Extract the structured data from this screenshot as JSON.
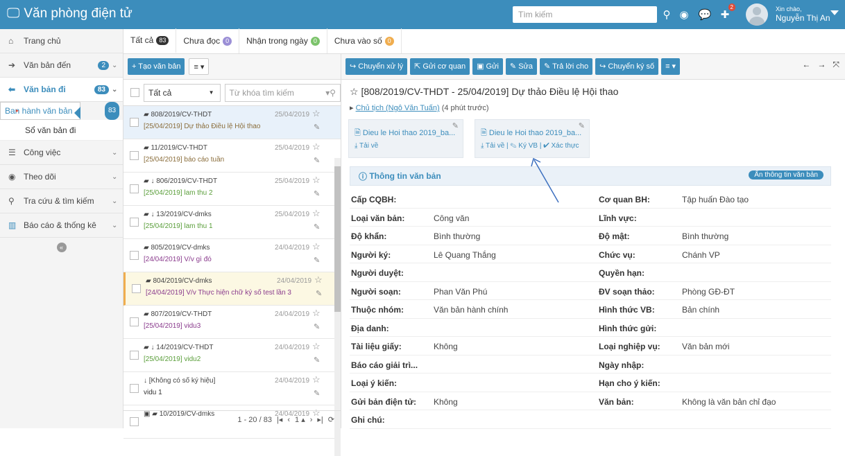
{
  "app": {
    "title": "Văn phòng điện tử"
  },
  "topbar": {
    "search_placeholder": "Tìm kiếm",
    "notif_count": "2",
    "greeting": "Xin chào,",
    "user_name": "Nguyễn Thị An"
  },
  "sidebar": {
    "items": [
      {
        "label": "Trang chủ",
        "icon": "home-icon"
      },
      {
        "label": "Văn bản đến",
        "badge": "2",
        "icon": "arrow-right-circle-icon"
      },
      {
        "label": "Văn bản đi",
        "badge": "83",
        "icon": "arrow-left-circle-icon"
      },
      {
        "label": "Công việc",
        "icon": "tasks-icon"
      },
      {
        "label": "Theo dõi",
        "icon": "eye-icon"
      },
      {
        "label": "Tra cứu & tìm kiếm",
        "icon": "search-icon"
      },
      {
        "label": "Báo cáo & thống kê",
        "icon": "bar-chart-icon"
      }
    ],
    "subitems": [
      {
        "label": "Ban hành văn bản",
        "badge": "83"
      },
      {
        "label": "Sổ văn bản đi"
      }
    ]
  },
  "tabs": [
    {
      "label": "Tất cả",
      "badge": "83",
      "color": "#333333"
    },
    {
      "label": "Chưa đọc",
      "badge": "0",
      "color": "#9b8fd6"
    },
    {
      "label": "Nhận trong ngày",
      "badge": "0",
      "color": "#7cc36b"
    },
    {
      "label": "Chưa vào số",
      "badge": "0",
      "color": "#f0ad4e"
    }
  ],
  "list_toolbar": {
    "new_label": "+ Tạo văn bản",
    "menu_label": "≡ ▾"
  },
  "filter": {
    "select_value": "Tất cả",
    "keyword_placeholder": "Từ khóa tìm kiếm"
  },
  "list": [
    {
      "code": "808/2019/CV-THDT",
      "date": "25/04/2019",
      "summary": "[25/04/2019] Dự thảo Điều lệ Hội thao",
      "style": "hl"
    },
    {
      "code": "11/2019/CV-THDT",
      "date": "25/04/2019",
      "summary": "[25/04/2019] báo cáo tuần",
      "style": ""
    },
    {
      "code": "806/2019/CV-THDT",
      "date": "25/04/2019",
      "summary": "[25/04/2019] lam thu 2",
      "style": "green",
      "down": true
    },
    {
      "code": "13/2019/CV-dmks",
      "date": "25/04/2019",
      "summary": "[25/04/2019] lam thu 1",
      "style": "green",
      "down": true
    },
    {
      "code": "805/2019/CV-dmks",
      "date": "24/04/2019",
      "summary": "[24/04/2019] V/v gì đó",
      "style": "purple"
    },
    {
      "code": "804/2019/CV-dmks",
      "date": "24/04/2019",
      "summary": "[24/04/2019] V/v Thực hiện chữ ký số test lần 3",
      "style": "yel"
    },
    {
      "code": "807/2019/CV-THDT",
      "date": "24/04/2019",
      "summary": "[25/04/2019] vidu3",
      "style": "purple"
    },
    {
      "code": "14/2019/CV-THDT",
      "date": "24/04/2019",
      "summary": "[25/04/2019] vidu2",
      "style": "green",
      "down": true
    },
    {
      "code": "[Không có số ký hiệu]",
      "date": "24/04/2019",
      "summary": "vidu 1",
      "style": "plain",
      "down": true,
      "nobook": true
    },
    {
      "code": "10/2019/CV-dmks",
      "date": "24/04/2019",
      "summary": "",
      "style": "plain",
      "img": true
    }
  ],
  "pager": {
    "range": "1 - 20 / 83",
    "page": "1"
  },
  "right_toolbar": {
    "buttons": [
      "Chuyển xử lý",
      "Gửi cơ quan",
      "Gửi",
      "Sửa",
      "Trả lời cho",
      "Chuyển ký số"
    ],
    "menu_label": "≡ ▾"
  },
  "doc": {
    "title": "[808/2019/CV-THDT - 25/04/2019] Dự thảo Điều lệ Hội thao",
    "sender_link": "Chủ tịch (Ngô Văn Tuấn)",
    "sender_time": "(4 phút trước)",
    "attachments": [
      {
        "name": "Dieu le Hoi thao 2019_ba...",
        "actions": "Tải về"
      },
      {
        "name": "Dieu le Hoi thao 2019_ba...",
        "actions": "Tải về | ✎ Ký VB | ✔ Xác thực"
      }
    ],
    "info_title": "Thông tin văn bản",
    "hide_label": "Ẩn thông tin văn bản",
    "rows": [
      [
        "Cấp CQBH:",
        "",
        "Cơ quan BH:",
        "Tập huấn Đào tạo"
      ],
      [
        "Loại văn bản:",
        "Công văn",
        "Lĩnh vực:",
        ""
      ],
      [
        "Độ khẩn:",
        "Bình thường",
        "Độ mật:",
        "Bình thường"
      ],
      [
        "Người ký:",
        "Lê Quang Thắng",
        "Chức vụ:",
        "Chánh VP"
      ],
      [
        "Người duyệt:",
        "",
        "Quyền hạn:",
        ""
      ],
      [
        "Người soạn:",
        "Phan Văn Phú",
        "ĐV soạn thảo:",
        "Phòng GĐ-ĐT"
      ],
      [
        "Thuộc nhóm:",
        "Văn bản hành chính",
        "Hình thức VB:",
        "Bản chính"
      ],
      [
        "Địa danh:",
        "",
        "Hình thức gửi:",
        ""
      ],
      [
        "Tài liệu giấy:",
        "Không",
        "Loại nghiệp vụ:",
        "Văn bản mới"
      ],
      [
        "Báo cáo giải trì...",
        "",
        "Ngày nhập:",
        ""
      ],
      [
        "Loại ý kiến:",
        "",
        "Hạn cho ý kiến:",
        ""
      ],
      [
        "Gửi bản điện tử:",
        "Không",
        "Văn bản:",
        "Không là văn bản chỉ đạo"
      ],
      [
        "Ghi chú:",
        "",
        "",
        ""
      ]
    ]
  }
}
